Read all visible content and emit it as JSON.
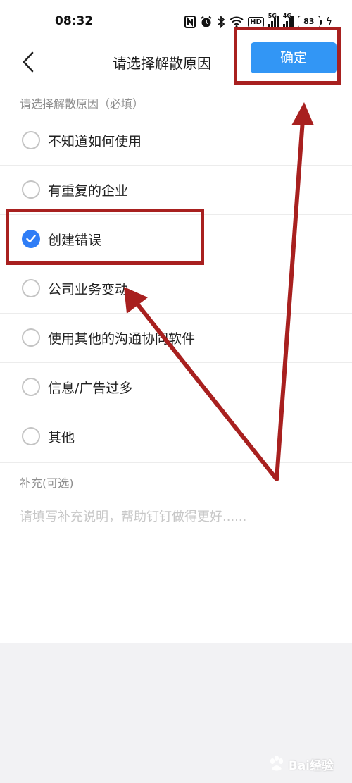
{
  "status_bar": {
    "time": "08:32",
    "hd": "HD",
    "signal1": "5G",
    "signal2": "4G",
    "battery": "83"
  },
  "nav": {
    "title": "请选择解散原因",
    "confirm_label": "确定",
    "back_icon": "chevron-left-icon"
  },
  "reasons": {
    "label": "请选择解散原因（必填）",
    "options": [
      {
        "label": "不知道如何使用",
        "checked": false
      },
      {
        "label": "有重复的企业",
        "checked": false
      },
      {
        "label": "创建错误",
        "checked": true
      },
      {
        "label": "公司业务变动",
        "checked": false
      },
      {
        "label": "使用其他的沟通协同软件",
        "checked": false
      },
      {
        "label": "信息/广告过多",
        "checked": false
      },
      {
        "label": "其他",
        "checked": false
      }
    ]
  },
  "supplement": {
    "label": "补充(可选)",
    "placeholder": "请填写补充说明，帮助钉钉做得更好......",
    "value": ""
  },
  "watermark": {
    "text": "Bai经验",
    "icon": "baidu-paw-icon"
  },
  "colors": {
    "accent": "#3296f5",
    "radio_checked": "#2f7df6",
    "annotation": "#a8201f"
  }
}
